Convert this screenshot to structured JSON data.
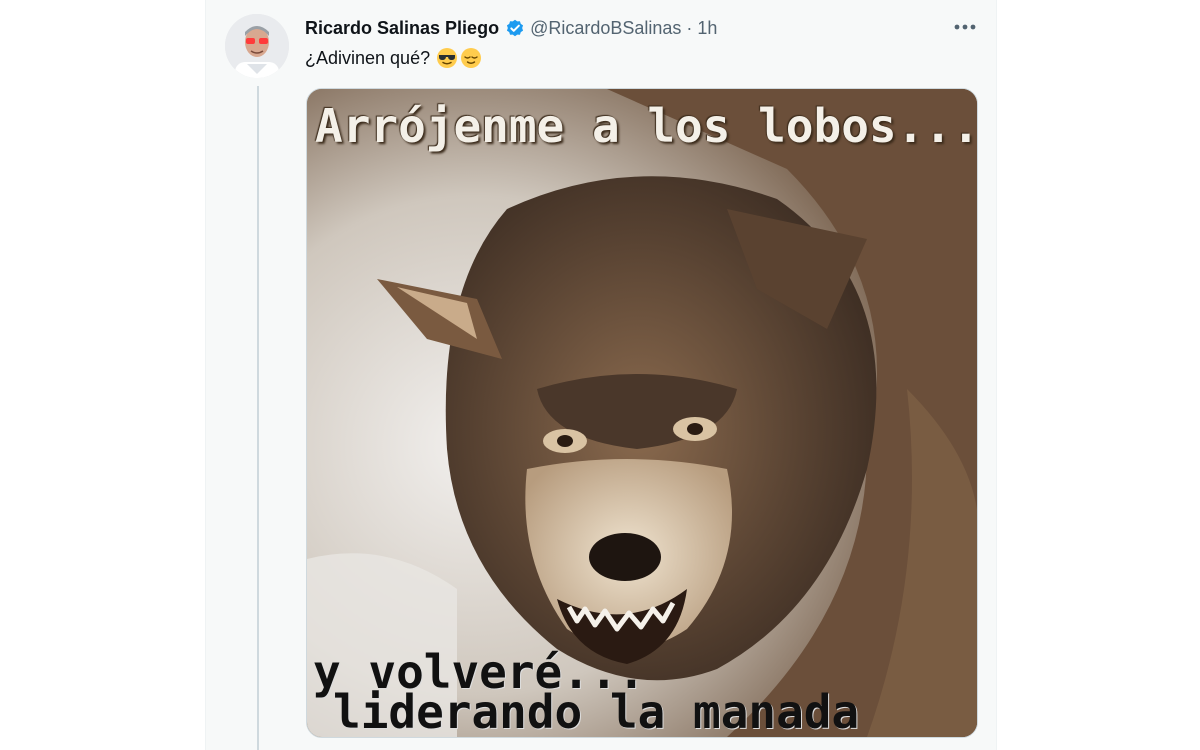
{
  "tweet": {
    "display_name": "Ricardo Salinas Pliego",
    "verified": true,
    "handle": "@RicardoBSalinas",
    "separator": "·",
    "timestamp": "1h",
    "text": "¿Adivinen qué?",
    "emojis": [
      "smiling-face-with-sunglasses",
      "relieved-face"
    ]
  },
  "media": {
    "description_icon": "wolf-photo",
    "caption_top": "Arrójenme a los lobos...",
    "caption_bottom_line1": "y volveré...",
    "caption_bottom_line2": "liderando la manada"
  },
  "colors": {
    "verified_blue": "#1d9bf0",
    "text_primary": "#0f1419",
    "text_secondary": "#536471"
  }
}
